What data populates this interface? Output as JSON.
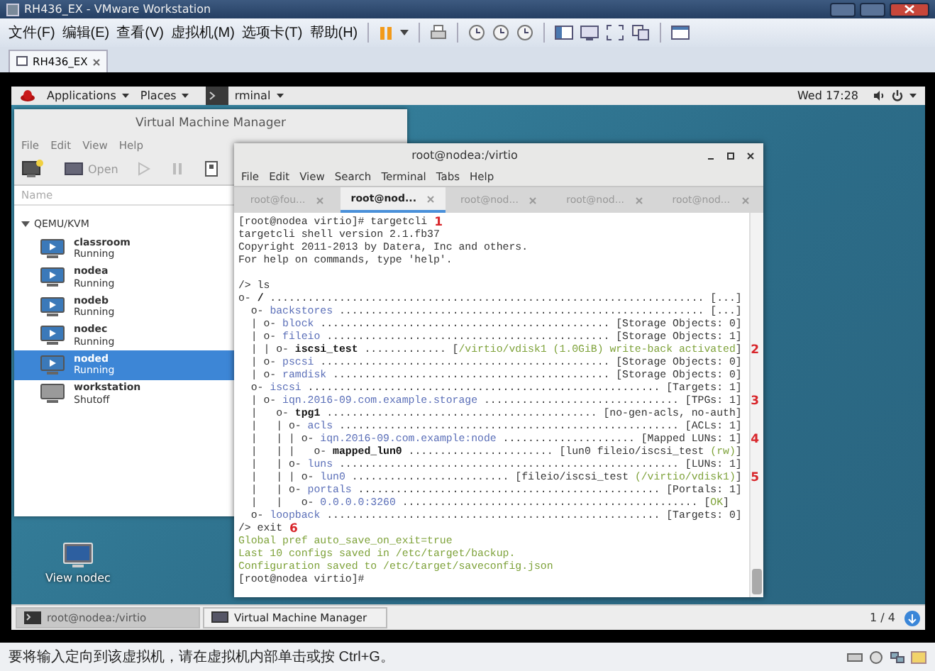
{
  "window": {
    "title": "RH436_EX - VMware Workstation"
  },
  "menu": [
    "文件(F)",
    "编辑(E)",
    "查看(V)",
    "虚拟机(M)",
    "选项卡(T)",
    "帮助(H)"
  ],
  "tabs": [
    {
      "label": "RH436_EX",
      "selected": true
    }
  ],
  "guest": {
    "top_bar": {
      "menus": [
        "Applications",
        "Places",
        "rminal"
      ],
      "clock": "Wed 17:28"
    },
    "vm_manager": {
      "title": "Virtual Machine Manager",
      "menu": [
        "File",
        "Edit",
        "View",
        "Help"
      ],
      "open_label": "Open",
      "column": "Name",
      "group": {
        "label": "QEMU/KVM",
        "expanded": true
      },
      "vms": [
        {
          "name": "classroom",
          "status": "Running",
          "running": true,
          "selected": false
        },
        {
          "name": "nodea",
          "status": "Running",
          "running": true,
          "selected": false
        },
        {
          "name": "nodeb",
          "status": "Running",
          "running": true,
          "selected": false
        },
        {
          "name": "nodec",
          "status": "Running",
          "running": true,
          "selected": false
        },
        {
          "name": "noded",
          "status": "Running",
          "running": true,
          "selected": true
        },
        {
          "name": "workstation",
          "status": "Shutoff",
          "running": false,
          "selected": false
        }
      ]
    },
    "terminal": {
      "title": "root@nodea:/virtio",
      "menu": [
        "File",
        "Edit",
        "View",
        "Search",
        "Terminal",
        "Tabs",
        "Help"
      ],
      "tabs": [
        {
          "label": "root@fou...",
          "selected": false
        },
        {
          "label": "root@nod...",
          "selected": true
        },
        {
          "label": "root@nod...",
          "selected": false
        },
        {
          "label": "root@nod...",
          "selected": false
        },
        {
          "label": "root@nod...",
          "selected": false
        }
      ],
      "lines": [
        {
          "kind": "text",
          "text": "[root@nodea virtio]# targetcli",
          "mark": "1"
        },
        {
          "kind": "text",
          "text": "targetcli shell version 2.1.fb37"
        },
        {
          "kind": "text",
          "text": "Copyright 2011-2013 by Datera, Inc and others."
        },
        {
          "kind": "text",
          "text": "For help on commands, type 'help'."
        },
        {
          "kind": "text",
          "text": "/> ls"
        },
        {
          "kind": "leaf",
          "prefix": "o- ",
          "name": "/",
          "leader": " ..................................................................... ",
          "value": "[...]"
        },
        {
          "kind": "branch",
          "prefix": "  o- ",
          "name": "backstores",
          "leader": " .......................................................... ",
          "value": "[...]"
        },
        {
          "kind": "branch",
          "prefix": "  | o- ",
          "name": "block",
          "leader": " .............................................. ",
          "value": "[Storage Objects: 0]"
        },
        {
          "kind": "branch",
          "prefix": "  | o- ",
          "name": "fileio",
          "leader": " ............................................. ",
          "value": "[Storage Objects: 1]"
        },
        {
          "kind": "leaf",
          "prefix": "  | | o- ",
          "name": "iscsi_test",
          "leader": " ............. ",
          "value": "[",
          "detail": "/virtio/vdisk1 (1.0GiB) write-back activated",
          "close": "]",
          "mark": "2"
        },
        {
          "kind": "branch",
          "prefix": "  | o- ",
          "name": "pscsi",
          "leader": " .............................................. ",
          "value": "[Storage Objects: 0]"
        },
        {
          "kind": "branch",
          "prefix": "  | o- ",
          "name": "ramdisk",
          "leader": " ............................................ ",
          "value": "[Storage Objects: 0]"
        },
        {
          "kind": "branch",
          "prefix": "  o- ",
          "name": "iscsi",
          "leader": " ........................................................ ",
          "value": "[Targets: 1]"
        },
        {
          "kind": "branch",
          "prefix": "  | o- ",
          "name": "iqn.2016-09.com.example.storage",
          "leader": " ............................... ",
          "value": "[TPGs: 1]",
          "mark": "3"
        },
        {
          "kind": "leaf",
          "prefix": "  |   o- ",
          "name": "tpg1",
          "leader": " ........................................... ",
          "value": "[no-gen-acls, no-auth]"
        },
        {
          "kind": "branch",
          "prefix": "  |   | o- ",
          "name": "acls",
          "leader": " ...................................................... ",
          "value": "[ACLs: 1]"
        },
        {
          "kind": "branch",
          "prefix": "  |   | | o- ",
          "name": "iqn.2016-09.com.example:node",
          "leader": " ..................... ",
          "value": "[Mapped LUNs: 1]",
          "mark": "4"
        },
        {
          "kind": "leaf",
          "prefix": "  |   | |   o- ",
          "name": "mapped_lun0",
          "leader": " ....................... ",
          "value": "[lun0 fileio/iscsi_test ",
          "detail": "(rw)",
          "close": "]"
        },
        {
          "kind": "branch",
          "prefix": "  |   | o- ",
          "name": "luns",
          "leader": " ...................................................... ",
          "value": "[LUNs: 1]"
        },
        {
          "kind": "branch",
          "prefix": "  |   | | o- ",
          "name": "lun0",
          "leader": " ......................... ",
          "value": "[fileio/iscsi_test ",
          "detail": "(/virtio/vdisk1)",
          "close": "]",
          "mark": "5"
        },
        {
          "kind": "branch",
          "prefix": "  |   | o- ",
          "name": "portals",
          "leader": " ................................................ ",
          "value": "[Portals: 1]"
        },
        {
          "kind": "branch",
          "prefix": "  |   |   o- ",
          "name": "0.0.0.0:3260",
          "leader": " ............................................... ",
          "value": "[",
          "detail": "OK",
          "close": "]"
        },
        {
          "kind": "branch",
          "prefix": "  o- ",
          "name": "loopback",
          "leader": " ..................................................... ",
          "value": "[Targets: 0]"
        },
        {
          "kind": "text",
          "text": "/> exit",
          "mark": "6"
        },
        {
          "kind": "message",
          "text": "Global pref auto_save_on_exit=true"
        },
        {
          "kind": "message",
          "text": "Last 10 configs saved in /etc/target/backup."
        },
        {
          "kind": "message",
          "text": "Configuration saved to /etc/target/saveconfig.json"
        },
        {
          "kind": "text",
          "text": "[root@nodea virtio]#"
        }
      ]
    },
    "desktop_icons": [
      {
        "label": "View nodec"
      }
    ],
    "taskbar": {
      "items": [
        {
          "label": "root@nodea:/virtio",
          "kind": "terminal",
          "selected": true
        },
        {
          "label": "Virtual Machine Manager",
          "kind": "vm_manager",
          "selected": false
        }
      ],
      "workspace": "1 / 4"
    }
  },
  "status_bar": {
    "message": "要将输入定向到该虚拟机，请在虚拟机内部单击或按 Ctrl+G。"
  }
}
